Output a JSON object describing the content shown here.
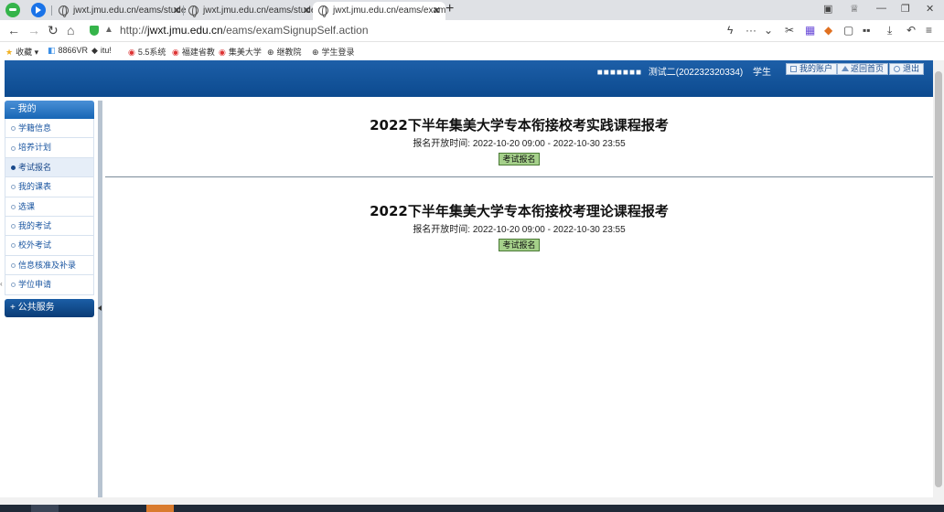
{
  "browser": {
    "tabs": [
      {
        "label": "jwxt.jmu.edu.cn/eams/stude",
        "active": false
      },
      {
        "label": "jwxt.jmu.edu.cn/eams/stude",
        "active": false
      },
      {
        "label": "jwxt.jmu.edu.cn/eams/exam",
        "active": true
      }
    ],
    "url_prefix": "http://",
    "url_domain": "jwxt.jmu.edu.cn",
    "url_path": "/eams/examSignupSelf.action",
    "bookmarks": [
      {
        "icon": "star-icon",
        "label": "收藏 ▾"
      },
      {
        "icon": "bookmark-icon",
        "label": "8866VR"
      },
      {
        "icon": "bird-icon",
        "label": "itu!"
      },
      {
        "icon": "target-icon",
        "label": "5.5系统"
      },
      {
        "icon": "target-icon",
        "label": "福建省教"
      },
      {
        "icon": "target-icon",
        "label": "集美大学"
      },
      {
        "icon": "globe-icon",
        "label": "继教院"
      },
      {
        "icon": "globe-icon",
        "label": "学生登录"
      }
    ]
  },
  "header": {
    "user_squares": "■■■■■■■",
    "user_name": "测试二(202232320334)",
    "user_role": "学生",
    "account_label": "我的账户",
    "home_label": "返回首页",
    "logout_label": "退出"
  },
  "sidebar": {
    "section_mine": "我的",
    "items": [
      {
        "label": "学籍信息",
        "active": false
      },
      {
        "label": "培养计划",
        "active": false
      },
      {
        "label": "考试报名",
        "active": true
      },
      {
        "label": "我的课表",
        "active": false
      },
      {
        "label": "选课",
        "active": false
      },
      {
        "label": "我的考试",
        "active": false
      },
      {
        "label": "校外考试",
        "active": false
      },
      {
        "label": "信息核准及补录",
        "active": false
      },
      {
        "label": "学位申请",
        "active": false
      }
    ],
    "section_public": "公共服务"
  },
  "exams": [
    {
      "title": "2022下半年集美大学专本衔接校考实践课程报考",
      "time": "报名开放时间: 2022-10-20 09:00 - 2022-10-30 23:55",
      "button": "考试报名"
    },
    {
      "title": "2022下半年集美大学专本衔接校考理论课程报考",
      "time": "报名开放时间: 2022-10-20 09:00 - 2022-10-30 23:55",
      "button": "考试报名"
    }
  ]
}
